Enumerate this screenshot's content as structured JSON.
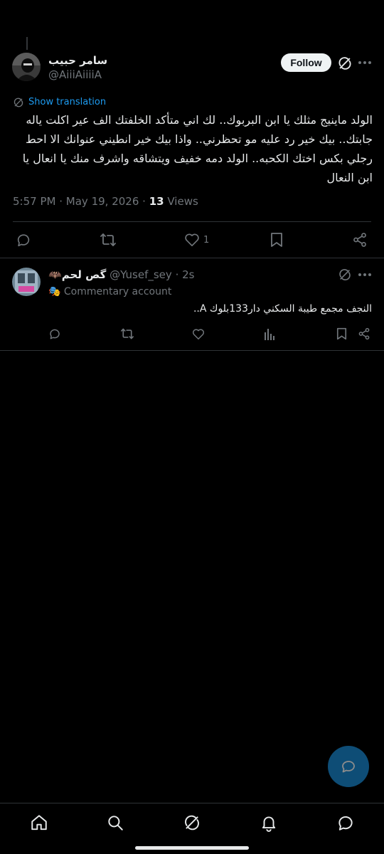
{
  "tweet": {
    "author_name": "سامر حبيب",
    "author_handle": "@AiiiAiiiiA",
    "follow_label": "Follow",
    "translation_label": "Show translation",
    "text": "الولد ماينيج مثلك يا ابن البربوك.. لك اني متأكد الخلفتك الف عير اكلت ياله جابتك.. بيك خير رد عليه مو تحظرني..  واذا بيك خير  انطيني عنوانك الا احط رجلي بكس اختك الكحبه..  الولد دمه خفيف ويتشاقه واشرف منك يا انعال يا ابن النعال",
    "time": "5:57 PM",
    "date": "May 19, 2026",
    "separator": "·",
    "views_count": "13",
    "views_label": "Views",
    "like_count": "1"
  },
  "reply": {
    "author_name": "🦇گص لحم",
    "author_handle": "@Yusef_sey",
    "separator": "·",
    "time_ago": "2s",
    "label_emoji": "🎭",
    "label_text": "Commentary account",
    "text": "النجف مجمع طيبة السكني دار133بلوك A.."
  },
  "colors": {
    "background": "#000000",
    "text": "#e7e9ea",
    "muted": "#71767b",
    "accent": "#1d9bf0",
    "divider": "#2f3336"
  },
  "icons": [
    "grok-icon",
    "more-icon",
    "translate-icon",
    "reply-icon",
    "repost-icon",
    "like-icon",
    "bookmark-icon",
    "share-icon",
    "views-icon",
    "compose-icon",
    "home-icon",
    "search-icon",
    "notifications-icon",
    "messages-icon"
  ]
}
